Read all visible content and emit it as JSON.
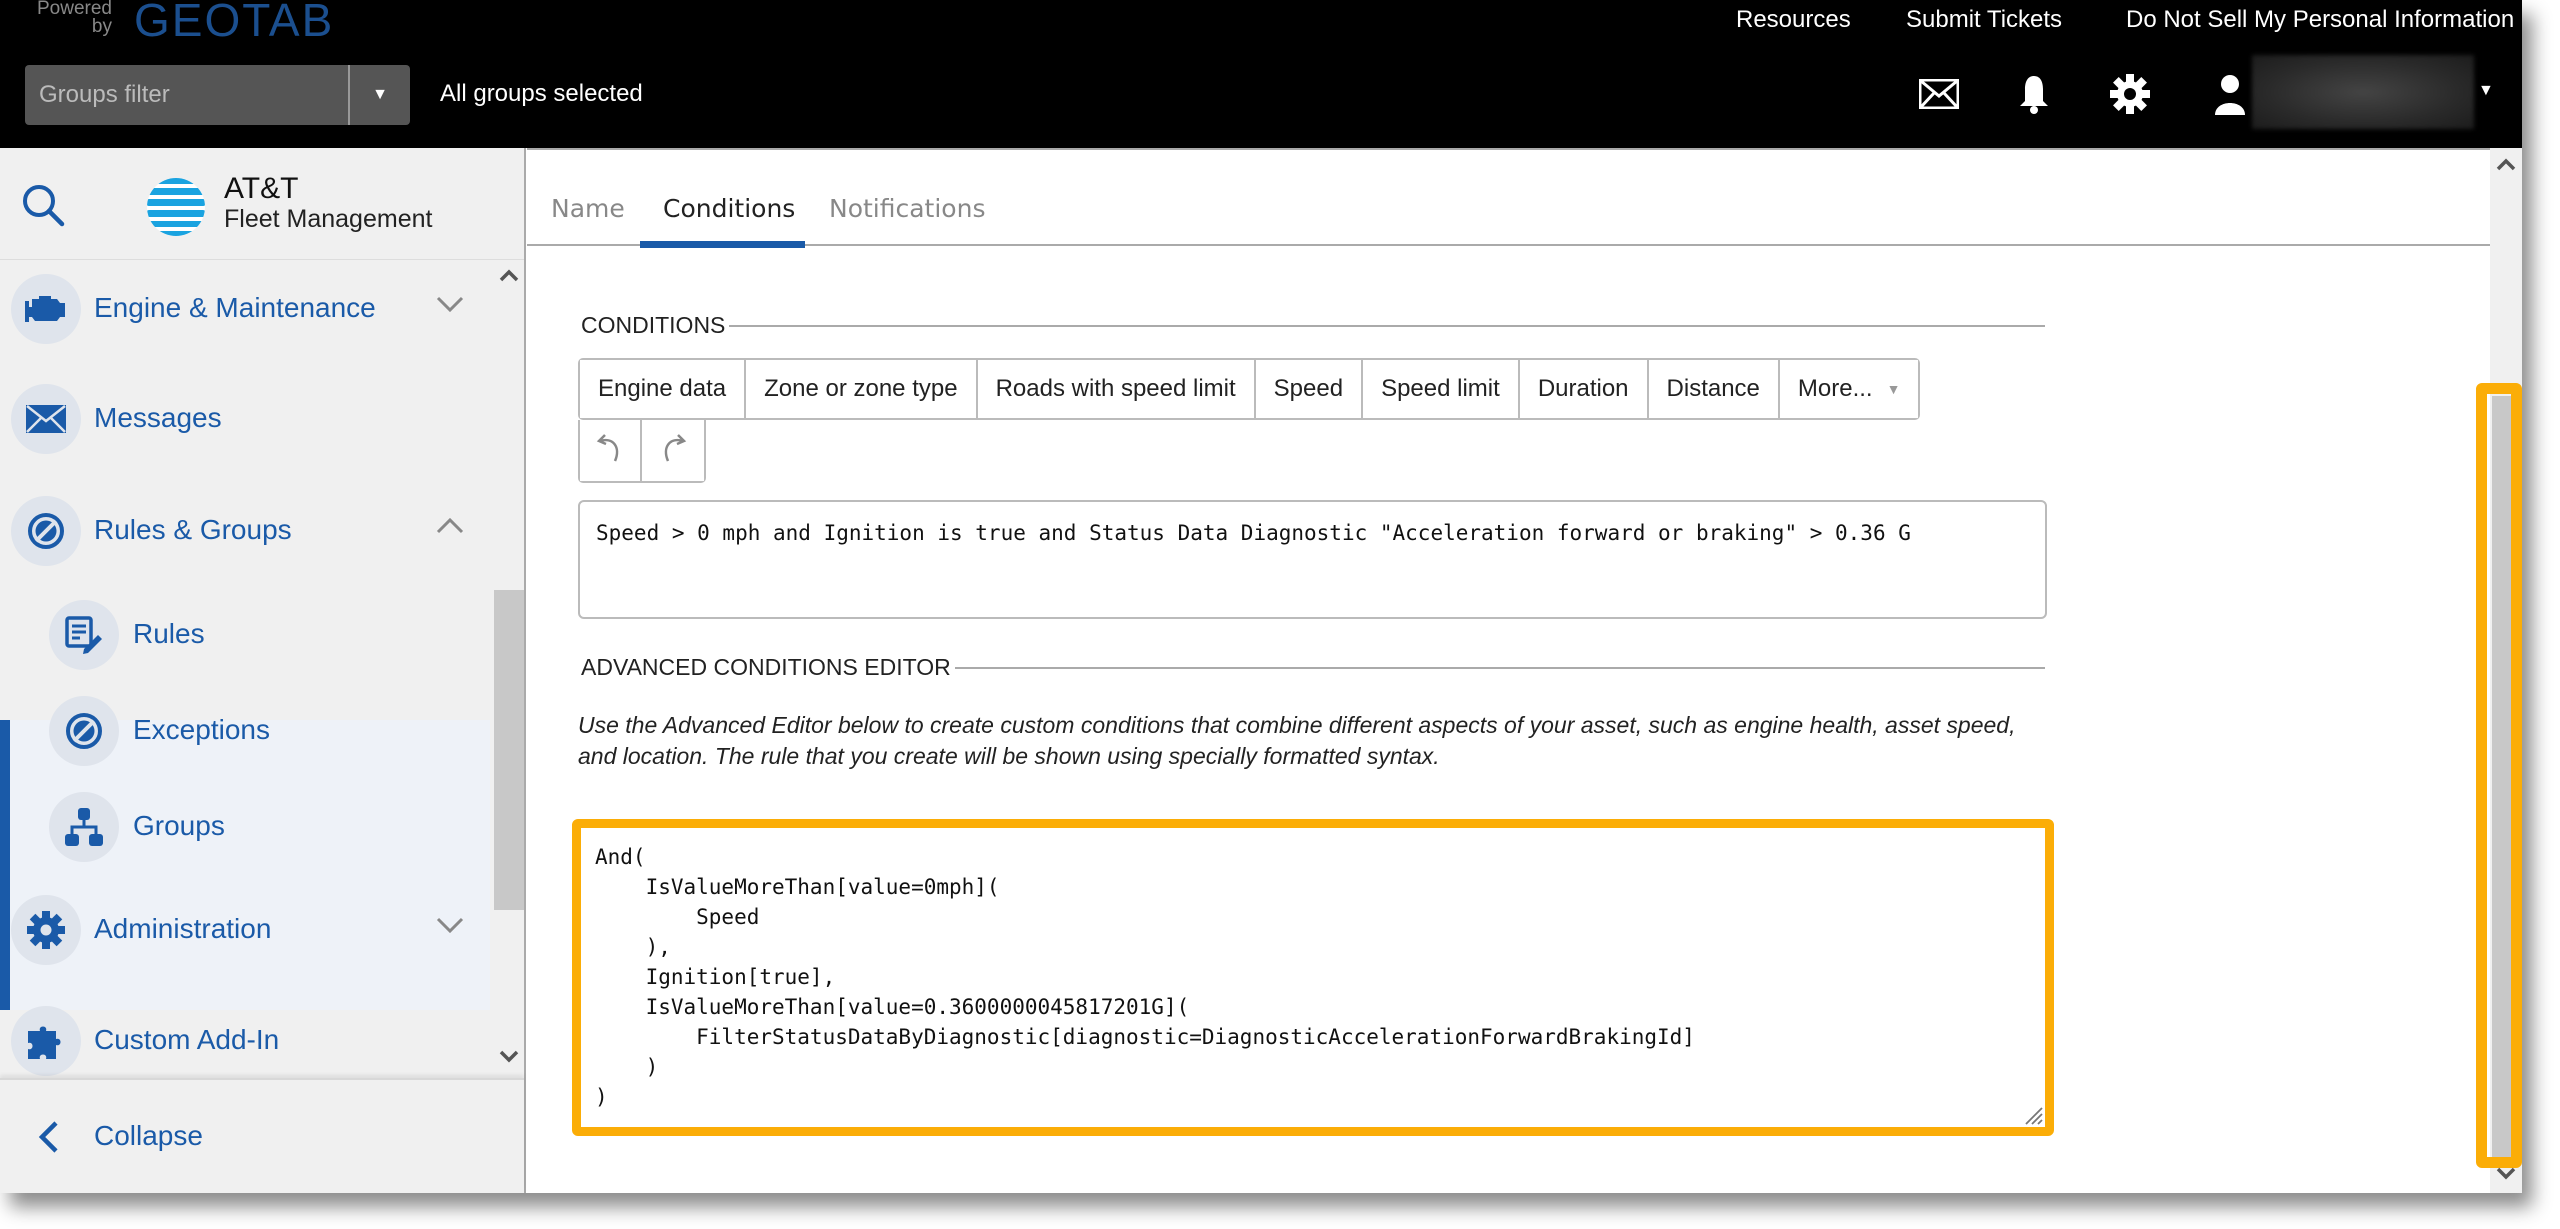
{
  "topbar": {
    "powered_by": "Powered by",
    "brand": "GEOTAB",
    "links": [
      "Resources",
      "Submit Tickets",
      "Do Not Sell My Personal Information"
    ],
    "groups_filter_placeholder": "Groups filter",
    "groups_status": "All groups selected",
    "icons": [
      "mail-icon",
      "bell-icon",
      "gear-icon",
      "user-icon"
    ]
  },
  "sidebar": {
    "brand_name": "AT&T",
    "brand_sub": "Fleet Management",
    "items": [
      {
        "label": "Engine & Maintenance",
        "icon": "engine-icon",
        "expanded": false
      },
      {
        "label": "Messages",
        "icon": "envelope-icon"
      },
      {
        "label": "Rules & Groups",
        "icon": "prohibit-icon",
        "expanded": true
      },
      {
        "label": "Rules",
        "icon": "rule-edit-icon",
        "sub": true
      },
      {
        "label": "Exceptions",
        "icon": "prohibit-icon",
        "sub": true
      },
      {
        "label": "Groups",
        "icon": "hierarchy-icon",
        "sub": true
      },
      {
        "label": "Administration",
        "icon": "gear-icon",
        "expanded": false
      },
      {
        "label": "Custom Add-In",
        "icon": "puzzle-icon"
      }
    ],
    "collapse_label": "Collapse"
  },
  "tabs": [
    {
      "label": "Name",
      "active": false
    },
    {
      "label": "Conditions",
      "active": true
    },
    {
      "label": "Notifications",
      "active": false
    }
  ],
  "conditions": {
    "heading": "CONDITIONS",
    "toolbar": [
      "Engine data",
      "Zone or zone type",
      "Roads with speed limit",
      "Speed",
      "Speed limit",
      "Duration",
      "Distance",
      "More..."
    ],
    "summary": "Speed > 0 mph and Ignition is true and Status Data Diagnostic \"Acceleration forward or braking\" > 0.36 G"
  },
  "advanced": {
    "heading": "ADVANCED CONDITIONS EDITOR",
    "description": "Use the Advanced Editor below to create custom conditions that combine different aspects of your asset, such as engine health, asset speed, and location. The rule that you create will be shown using specially formatted syntax.",
    "code": "And(\n    IsValueMoreThan[value=0mph](\n        Speed\n    ),\n    Ignition[true],\n    IsValueMoreThan[value=0.3600000045817201G](\n        FilterStatusDataByDiagnostic[diagnostic=DiagnosticAccelerationForwardBrakingId]\n    )\n)"
  },
  "colors": {
    "accent_blue": "#1a5aa8",
    "highlight_orange": "#fbad07",
    "topbar_bg": "#000000"
  }
}
